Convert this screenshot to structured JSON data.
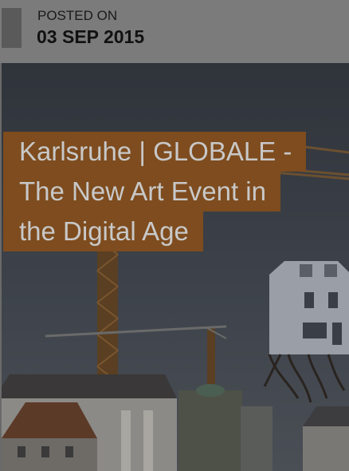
{
  "post": {
    "posted_label": "POSTED ON",
    "posted_date": "03 SEP 2015",
    "title_lines": [
      "Karlsruhe | GLOBALE -",
      "The New Art Event in",
      "the Digital Age"
    ]
  },
  "colors": {
    "title_background": "#7e4c1e",
    "title_text": "#c8c8c8",
    "header_background": "#7b7b7b"
  }
}
